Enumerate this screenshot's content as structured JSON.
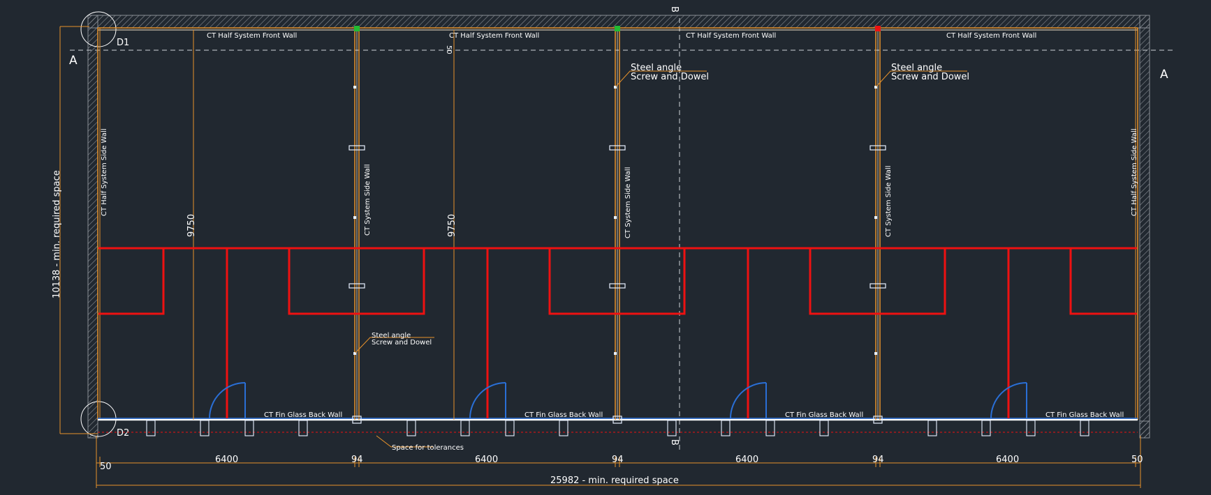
{
  "drawing": {
    "markers": {
      "section_a": "A",
      "section_b": "B",
      "detail_1": "D1",
      "detail_2": "D2"
    },
    "front_wall_label": "CT Half System Front Wall",
    "back_wall_label": "CT Fin Glass Back Wall",
    "side_wall_label": "CT System Side Wall",
    "half_side_wall_label": "CT Half System Side Wall",
    "steel_angle_label": "Steel angle",
    "screw_label": "Screw and Dowel",
    "tolerance_label": "Space for tolerances",
    "dim_depth": "9750",
    "dim_cross_top": "50",
    "dim_total_height": "10138 - min. required space",
    "dim_total_width": "25982 - min. required space",
    "dim_module": "6400",
    "dim_joint": "94",
    "dim_end_left": "50",
    "dim_end_right": "50"
  },
  "colors": {
    "background": "#212830",
    "wall_orange": "#e8922a",
    "partition_red": "#ee1111",
    "door_blue": "#2a6fd6",
    "text_white": "#ffffff",
    "hatch_grey": "#8a8f96"
  }
}
